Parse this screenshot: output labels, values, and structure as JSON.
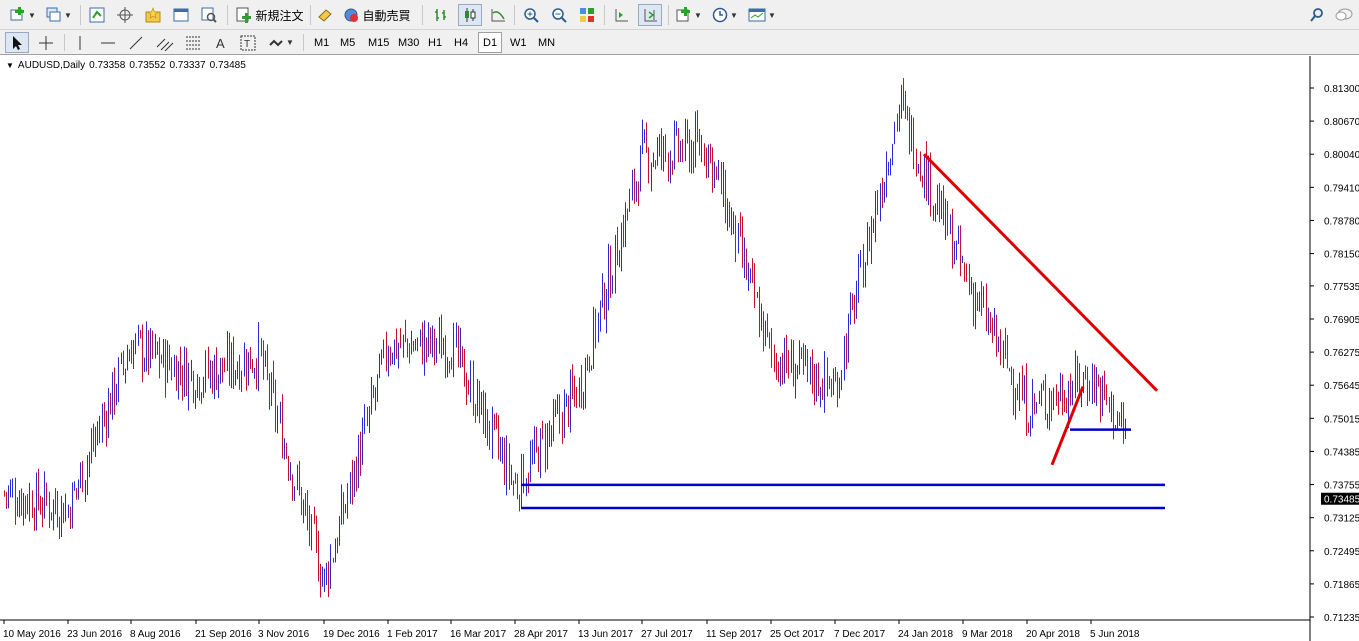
{
  "toolbar": {
    "new_order_label": "新規注文",
    "auto_trade_label": "自動売買"
  },
  "timeframes": [
    {
      "label": "M1",
      "active": false
    },
    {
      "label": "M5",
      "active": false
    },
    {
      "label": "M15",
      "active": false
    },
    {
      "label": "M30",
      "active": false
    },
    {
      "label": "H1",
      "active": false
    },
    {
      "label": "H4",
      "active": false
    },
    {
      "label": "D1",
      "active": true
    },
    {
      "label": "W1",
      "active": false
    },
    {
      "label": "MN",
      "active": false
    }
  ],
  "chart": {
    "symbol": "AUDUSD,Daily",
    "open": "0.73358",
    "high": "0.73552",
    "low": "0.73337",
    "close": "0.73485",
    "current_price_label": "0.73485"
  },
  "chart_data": {
    "type": "bar",
    "price_ticks": [
      "0.81300",
      "0.80670",
      "0.80040",
      "0.79410",
      "0.78780",
      "0.78150",
      "0.77535",
      "0.76905",
      "0.76275",
      "0.75645",
      "0.75015",
      "0.74385",
      "0.73755",
      "0.73125",
      "0.72495",
      "0.71865",
      "0.71235"
    ],
    "date_ticks": [
      "10 May 2016",
      "23 Jun 2016",
      "8 Aug 2016",
      "21 Sep 2016",
      "3 Nov 2016",
      "19 Dec 2016",
      "1 Feb 2017",
      "16 Mar 2017",
      "28 Apr 2017",
      "13 Jun 2017",
      "27 Jul 2017",
      "11 Sep 2017",
      "25 Oct 2017",
      "7 Dec 2017",
      "24 Jan 2018",
      "9 Mar 2018",
      "20 Apr 2018",
      "5 Jun 2018"
    ],
    "ylim": [
      0.71235,
      0.813
    ],
    "series_anchors": [
      {
        "date": "10 May 2016",
        "close": 0.736
      },
      {
        "date": "23 Jun 2016",
        "close": 0.733
      },
      {
        "date": "8 Aug 2016",
        "close": 0.764
      },
      {
        "date": "21 Sep 2016",
        "close": 0.758
      },
      {
        "date": "3 Nov 2016",
        "close": 0.762
      },
      {
        "date": "19 Dec 2016",
        "close": 0.719
      },
      {
        "date": "1 Feb 2017",
        "close": 0.764
      },
      {
        "date": "16 Mar 2017",
        "close": 0.764
      },
      {
        "date": "28 Apr 2017",
        "close": 0.737
      },
      {
        "date": "13 Jun 2017",
        "close": 0.756
      },
      {
        "date": "27 Jul 2017",
        "close": 0.8
      },
      {
        "date": "11 Sep 2017",
        "close": 0.802
      },
      {
        "date": "25 Oct 2017",
        "close": 0.762
      },
      {
        "date": "7 Dec 2017",
        "close": 0.756
      },
      {
        "date": "24 Jan 2018",
        "close": 0.81
      },
      {
        "date": "9 Mar 2018",
        "close": 0.778
      },
      {
        "date": "20 Apr 2018",
        "close": 0.752
      },
      {
        "date": "5 Jun 2018",
        "close": 0.758
      },
      {
        "date": "end",
        "close": 0.73485
      }
    ],
    "annotations": [
      {
        "type": "trendline",
        "color": "#dd0000",
        "from": {
          "date": "24 Jan 2018",
          "price": 0.8004
        },
        "to": {
          "date": "end",
          "price": 0.7554
        }
      },
      {
        "type": "trendline",
        "color": "#dd0000",
        "from": {
          "date": "20 Apr 2018",
          "price": 0.7413
        },
        "to": {
          "date": "5 Jun 2018",
          "price": 0.7562
        }
      },
      {
        "type": "hline",
        "color": "#0000cc",
        "price": 0.748,
        "from": "20 Apr 2018",
        "to": "5 Jun 2018"
      },
      {
        "type": "hline",
        "color": "#0000cc",
        "price": 0.7375,
        "from": "28 Apr 2017",
        "to": "end"
      },
      {
        "type": "hline",
        "color": "#0000cc",
        "price": 0.7331,
        "from": "28 Apr 2017",
        "to": "end"
      }
    ],
    "colors": {
      "up": "#2b2bd6",
      "down": "#c8102e",
      "trend": "#dd0000",
      "level": "#0000cc",
      "price_tag": "#000000"
    }
  }
}
